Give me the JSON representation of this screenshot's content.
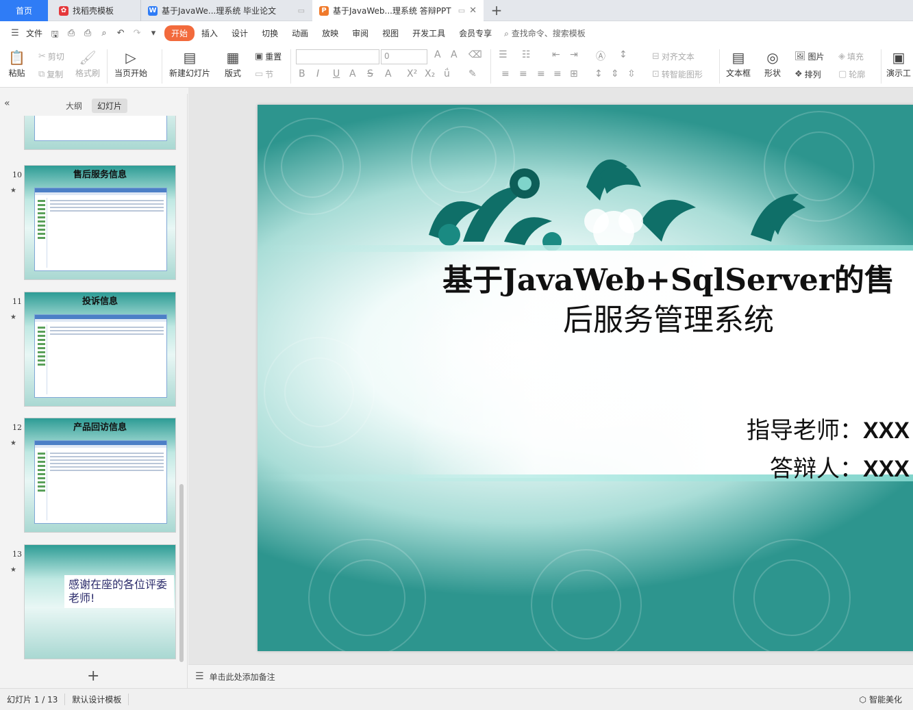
{
  "tabs": {
    "home": "首页",
    "t1": "找稻壳模板",
    "t2": "基于JavaWe...理系统 毕业论文",
    "t3": "基于JavaWeb...理系统 答辩PPT",
    "add": "+"
  },
  "menubar": {
    "file": "文件",
    "items": [
      "开始",
      "插入",
      "设计",
      "切换",
      "动画",
      "放映",
      "审阅",
      "视图",
      "开发工具",
      "会员专享"
    ],
    "search": "查找命令、搜索模板"
  },
  "ribbon": {
    "paste": "粘贴",
    "cut": "剪切",
    "copy": "复制",
    "format_painter": "格式刷",
    "from_current": "当页开始",
    "new_slide": "新建幻灯片",
    "layout": "版式",
    "reset": "重置",
    "section": "节",
    "font_size": "0",
    "align_text": "对齐文本",
    "smartart": "转智能图形",
    "textbox": "文本框",
    "shape": "形状",
    "picture": "图片",
    "arrange": "排列",
    "fill": "填充",
    "outline": "轮廓",
    "presentation_tools": "演示工"
  },
  "panel": {
    "tab_outline": "大纲",
    "tab_slides": "幻灯片",
    "slides": [
      {
        "num": "10",
        "title": "售后服务信息"
      },
      {
        "num": "11",
        "title": "投诉信息"
      },
      {
        "num": "12",
        "title": "产品回访信息"
      },
      {
        "num": "13",
        "title": "",
        "thanks": "感谢在座的各位评委老师!"
      }
    ]
  },
  "slide": {
    "title_line1": "基于JavaWeb+SqlServer的售",
    "title_line2": "后服务管理系统",
    "advisor_label": "指导老师：",
    "advisor_value": "XXX",
    "defender_label": "答辩人：",
    "defender_value": "XXX"
  },
  "notes": {
    "placeholder": "单击此处添加备注"
  },
  "status": {
    "slide_count": "幻灯片 1 / 13",
    "template": "默认设计模板",
    "beautify": "智能美化"
  },
  "colors": {
    "accent": "#f26a3c",
    "home_tab": "#2f7cf6",
    "teal": "#2d958e"
  }
}
